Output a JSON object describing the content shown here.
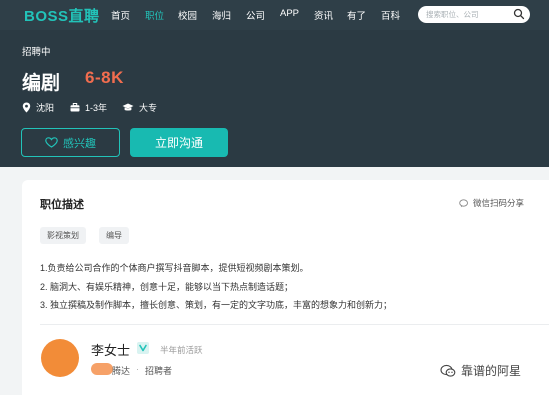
{
  "nav": {
    "logo": "BOSS直聘",
    "items": [
      "首页",
      "职位",
      "校园",
      "海归",
      "公司",
      "APP",
      "资讯",
      "有了",
      "百科"
    ],
    "active_index": 1,
    "search_placeholder": "搜索职位、公司"
  },
  "job": {
    "status": "招聘中",
    "title": "编剧",
    "salary": "6-8K",
    "location": "沈阳",
    "experience": "1-3年",
    "education": "大专",
    "interest_button": "感兴趣",
    "chat_button": "立即沟通"
  },
  "description": {
    "section_title": "职位描述",
    "share_label": "微信扫码分享",
    "tags": [
      "影视策划",
      "编导"
    ],
    "lines": [
      "1.负责给公司合作的个体商户撰写抖音脚本，提供短视频剧本策划。",
      "2. 脑洞大、有娱乐精神，创意十足，能够以当下热点制造话题；",
      "3. 独立撰稿及制作脚本，擅长创意、策划，有一定的文字功底，丰富的想象力和创新力；"
    ]
  },
  "recruiter": {
    "name": "李女士",
    "active_status": "半年前活跃",
    "company_partial": "腾达",
    "separator": "·",
    "role": "招聘者"
  },
  "watermark": {
    "text": "靠谱的阿星"
  },
  "colors": {
    "brand": "#22c3b9",
    "salary": "#f26d4f",
    "header_bg": "#2b3a43"
  }
}
